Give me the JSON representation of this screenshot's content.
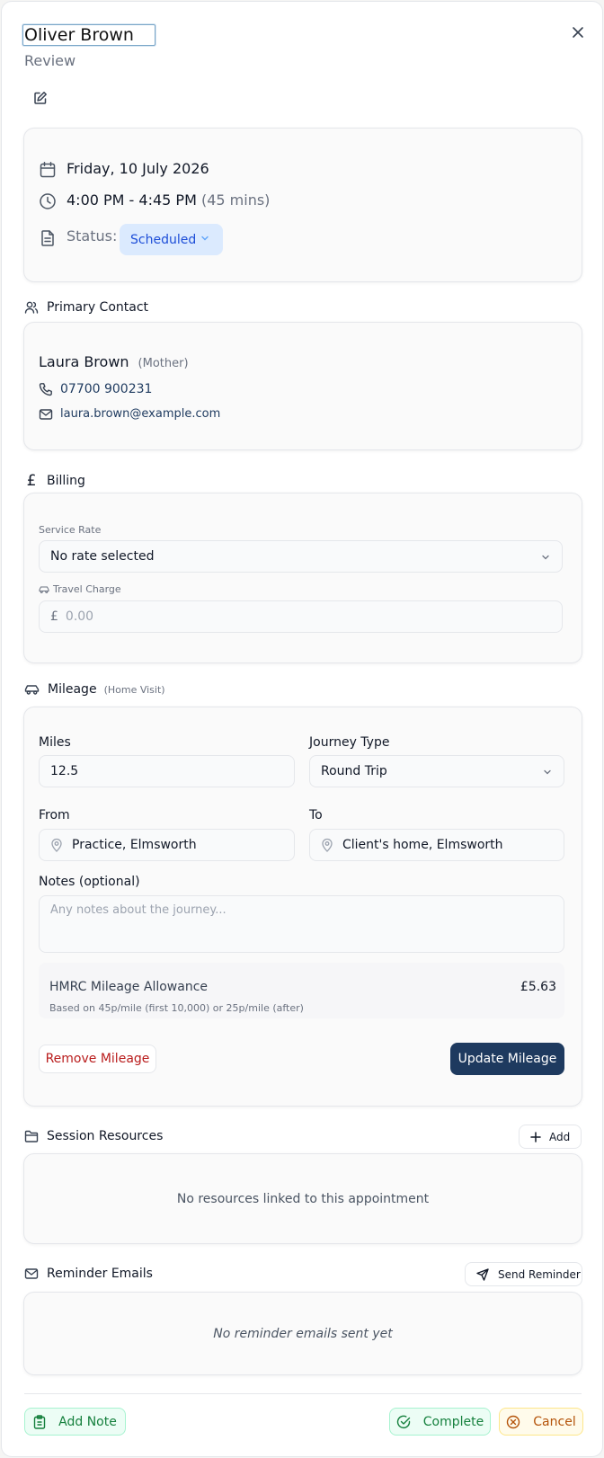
{
  "header": {
    "title_value": "Oliver Brown",
    "subtitle": "Review"
  },
  "details": {
    "date": "Friday, 10 July 2026",
    "time": "4:00 PM - 4:45 PM",
    "duration": "(45 mins)",
    "status_label": "Status:",
    "status_value": "Scheduled"
  },
  "primary_contact": {
    "heading": "Primary Contact",
    "name": "Laura Brown",
    "relation": "(Mother)",
    "phone": "07700 900231",
    "email": "laura.brown@example.com"
  },
  "billing": {
    "heading": "Billing",
    "service_rate_label": "Service Rate",
    "service_rate_value": "No rate selected",
    "travel_charge_label": "Travel Charge",
    "currency_symbol": "£",
    "travel_charge_placeholder": "0.00"
  },
  "mileage": {
    "heading": "Mileage",
    "heading_note": "(Home Visit)",
    "miles_label": "Miles",
    "miles_value": "12.5",
    "journey_type_label": "Journey Type",
    "journey_type_value": "Round Trip",
    "from_label": "From",
    "from_value": "Practice, Elmsworth",
    "to_label": "To",
    "to_value": "Client's home, Elmsworth",
    "notes_label": "Notes (optional)",
    "notes_placeholder": "Any notes about the journey...",
    "allowance_title": "HMRC Mileage Allowance",
    "allowance_note": "Based on 45p/mile (first 10,000) or 25p/mile (after)",
    "allowance_amount": "£5.63",
    "remove_label": "Remove Mileage",
    "update_label": "Update Mileage"
  },
  "resources": {
    "heading": "Session Resources",
    "add_label": "Add",
    "empty_text": "No resources linked to this appointment"
  },
  "reminders": {
    "heading": "Reminder Emails",
    "send_label": "Send Reminder",
    "empty_text": "No reminder emails sent yet"
  },
  "footer": {
    "add_note_label": "Add Note",
    "complete_label": "Complete",
    "cancel_label": "Cancel"
  },
  "colors": {
    "primary_dark": "#1e3a5f",
    "status_bg": "#dbeafe",
    "status_text": "#1d4ed8",
    "danger": "#b91c1c",
    "success_bg": "#ecfdf5",
    "success_text": "#15803d",
    "warning_bg": "#fffbeb",
    "warning_text": "#b45309"
  },
  "icons": [
    "close-icon",
    "edit-icon",
    "calendar-icon",
    "clock-icon",
    "document-icon",
    "chevron-down-icon",
    "users-icon",
    "phone-icon",
    "mail-icon",
    "pound-icon",
    "car-icon",
    "map-pin-icon",
    "folder-icon",
    "plus-icon",
    "send-icon",
    "clipboard-icon",
    "check-circle-icon",
    "x-circle-icon"
  ]
}
